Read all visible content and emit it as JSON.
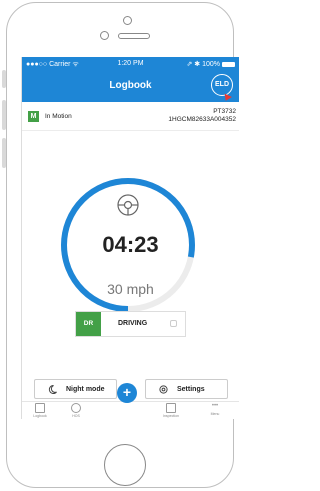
{
  "status_bar": {
    "carrier": "●●●○○ Carrier ᯤ",
    "time": "1:20 PM",
    "right": "⇗ ✱ 100%"
  },
  "nav": {
    "title": "Logbook",
    "eld_label": "ELD"
  },
  "vehicle": {
    "motion_badge": "M",
    "motion_label": "In Motion",
    "unit": "PT3732",
    "vin": "1HGCM82633A004352"
  },
  "timer": {
    "clock": "04:23",
    "speed": "30 mph",
    "progress": 0.78
  },
  "duty_status": {
    "code": "DR",
    "label": "DRIVING"
  },
  "actions": {
    "night_mode": "Night mode",
    "settings": "Settings"
  },
  "tabs": [
    {
      "label": "Logbook",
      "icon": "logbook-icon"
    },
    {
      "label": "HOS",
      "icon": "hos-icon"
    },
    {
      "label": "+",
      "icon": "add-icon"
    },
    {
      "label": "Inspection",
      "icon": "inspection-icon"
    },
    {
      "label": "Menu",
      "icon": "menu-icon"
    }
  ],
  "colors": {
    "primary": "#1e86d6",
    "driving": "#43a047",
    "alert": "#e53935"
  }
}
